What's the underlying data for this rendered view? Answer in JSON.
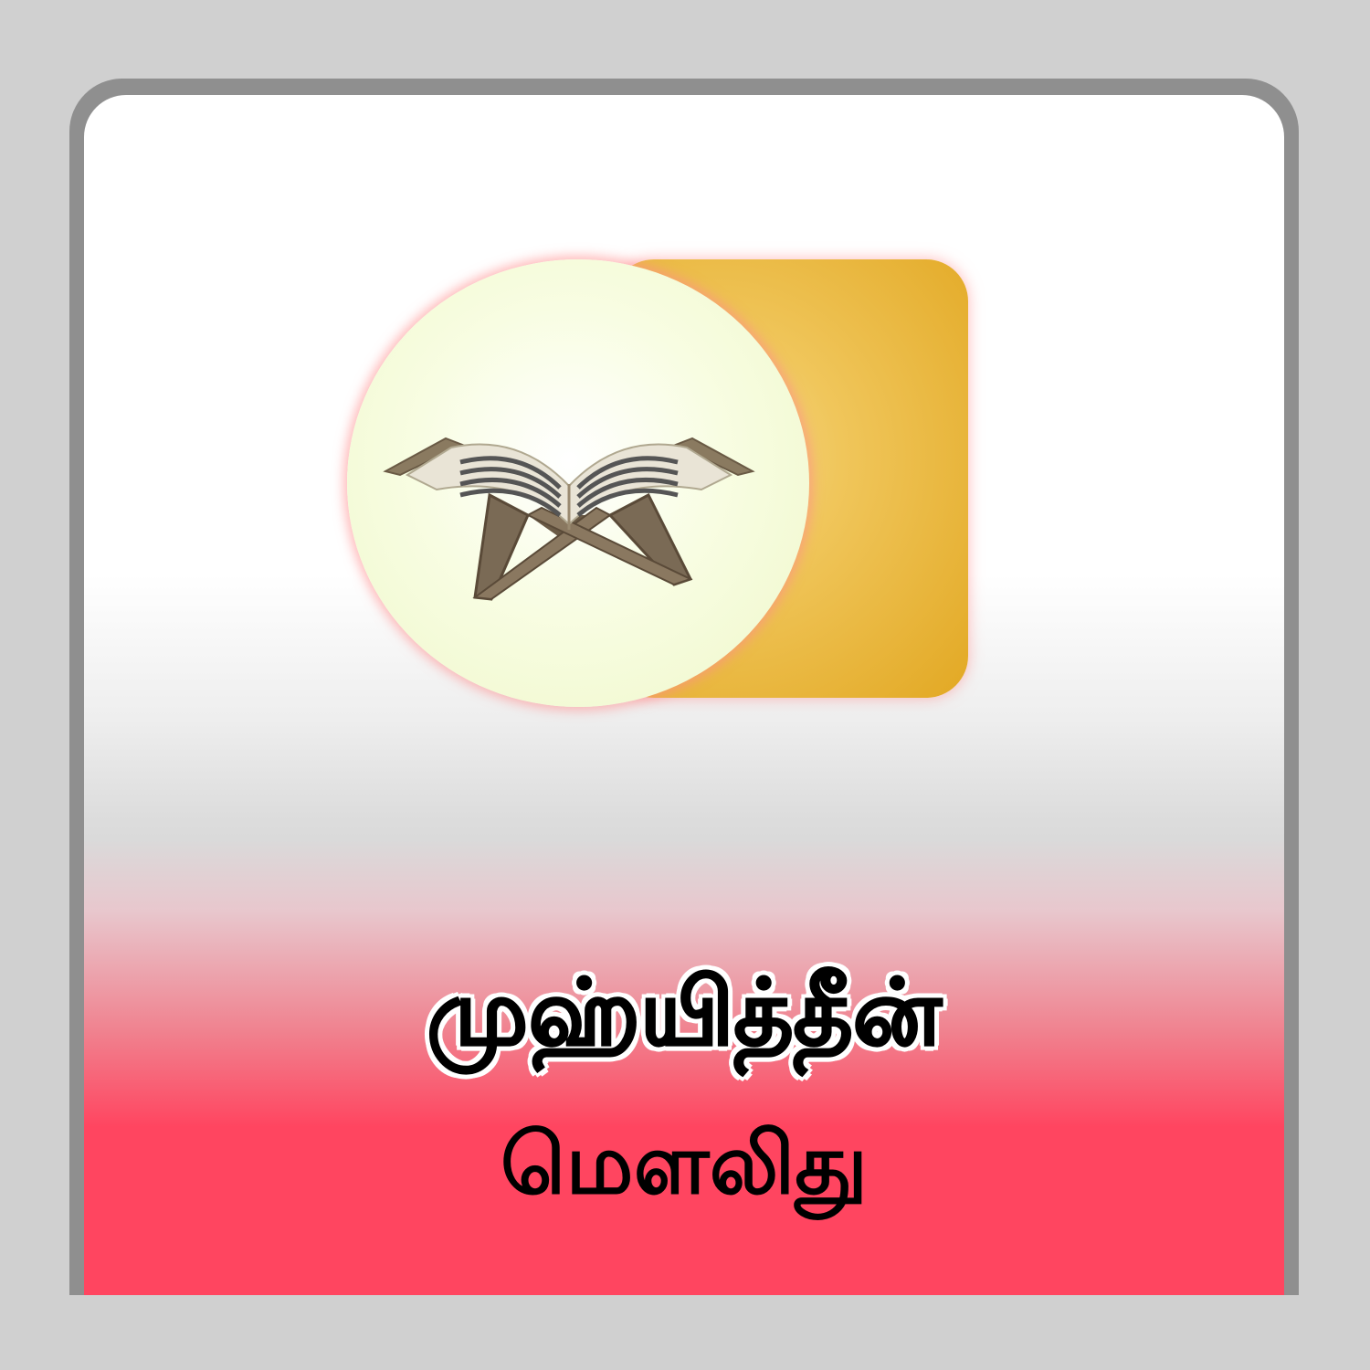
{
  "app": {
    "title": "முஹ்யித்தீன்",
    "subtitle": "மௌலிது"
  },
  "icons": {
    "logo": "quran-stand-icon"
  },
  "colors": {
    "background": "#d0d0d0",
    "frame": "#8f8f8f",
    "accent_pink": "#ff4560",
    "accent_gold": "#e2a823",
    "circle": "#f8fde2"
  }
}
